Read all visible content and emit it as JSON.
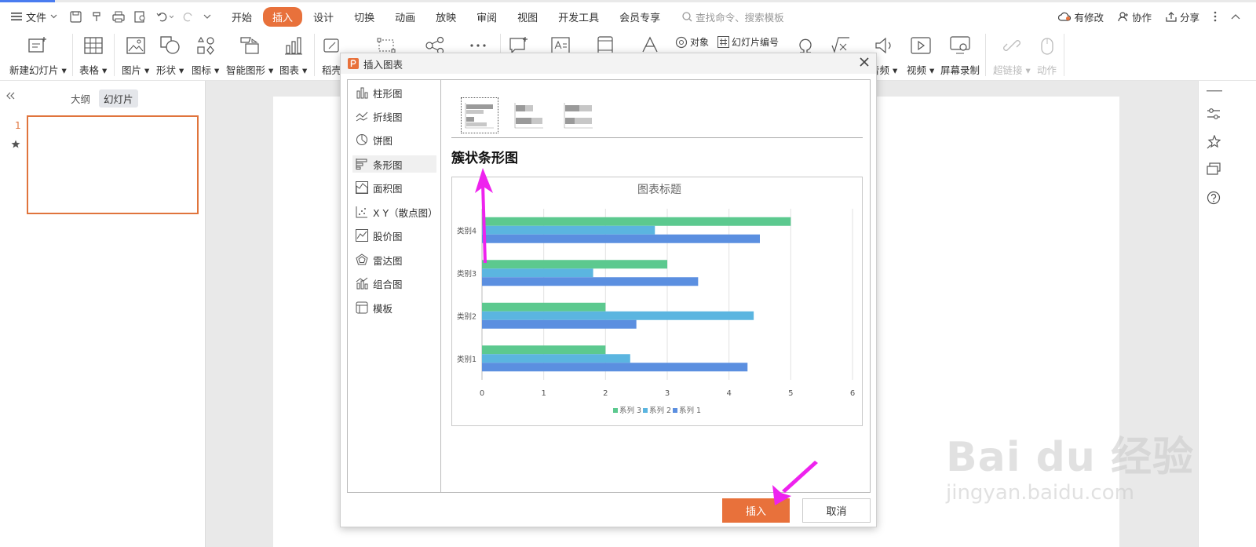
{
  "menubar": {
    "file_label": "文件",
    "tabs": [
      "开始",
      "插入",
      "设计",
      "切换",
      "动画",
      "放映",
      "审阅",
      "视图",
      "开发工具",
      "会员专享"
    ],
    "active_tab_index": 1,
    "search_placeholder": "查找命令、搜索模板",
    "right_items": [
      "有修改",
      "协作",
      "分享"
    ]
  },
  "ribbon": {
    "new_slide": "新建幻灯片",
    "table": "表格",
    "picture": "图片",
    "shape": "形状",
    "icon": "图标",
    "smartart": "智能图形",
    "chart": "图表",
    "daoke": "稻壳",
    "object": "对象",
    "slide_number": "幻灯片编号",
    "audio": "音频",
    "video": "视频",
    "screen_record": "屏幕录制",
    "hyperlink": "超链接",
    "action": "动作"
  },
  "left_panel": {
    "tab_outline": "大纲",
    "tab_slides": "幻灯片",
    "slide_number": "1"
  },
  "dialog": {
    "title": "插入图表",
    "chart_types": [
      "柱形图",
      "折线图",
      "饼图",
      "条形图",
      "面积图",
      "X Y（散点图）",
      "股价图",
      "雷达图",
      "组合图",
      "模板"
    ],
    "selected_type_index": 3,
    "preview_title": "簇状条形图",
    "insert_button": "插入",
    "cancel_button": "取消"
  },
  "chart_data": {
    "type": "bar",
    "orientation": "horizontal",
    "title": "图表标题",
    "categories": [
      "类别1",
      "类别2",
      "类别3",
      "类别4"
    ],
    "series": [
      {
        "name": "系列 1",
        "color": "#5b8fe0",
        "values": [
          4.3,
          2.5,
          3.5,
          4.5
        ]
      },
      {
        "name": "系列 2",
        "color": "#5bb5e0",
        "values": [
          2.4,
          4.4,
          1.8,
          2.8
        ]
      },
      {
        "name": "系列 3",
        "color": "#5cc98f",
        "values": [
          2.0,
          2.0,
          3.0,
          5.0
        ]
      }
    ],
    "xlim": [
      0,
      6
    ],
    "x_ticks": [
      0,
      1,
      2,
      3,
      4,
      5,
      6
    ],
    "grid": true,
    "legend_position": "bottom",
    "legend_order": [
      "系列 3",
      "系列 2",
      "系列 1"
    ]
  },
  "watermark": {
    "brand": "Bai du 经验",
    "url": "jingyan.baidu.com"
  },
  "colors": {
    "accent": "#e8713b",
    "slide_border": "#e0743c",
    "annotation_arrow": "#ee22ee"
  }
}
